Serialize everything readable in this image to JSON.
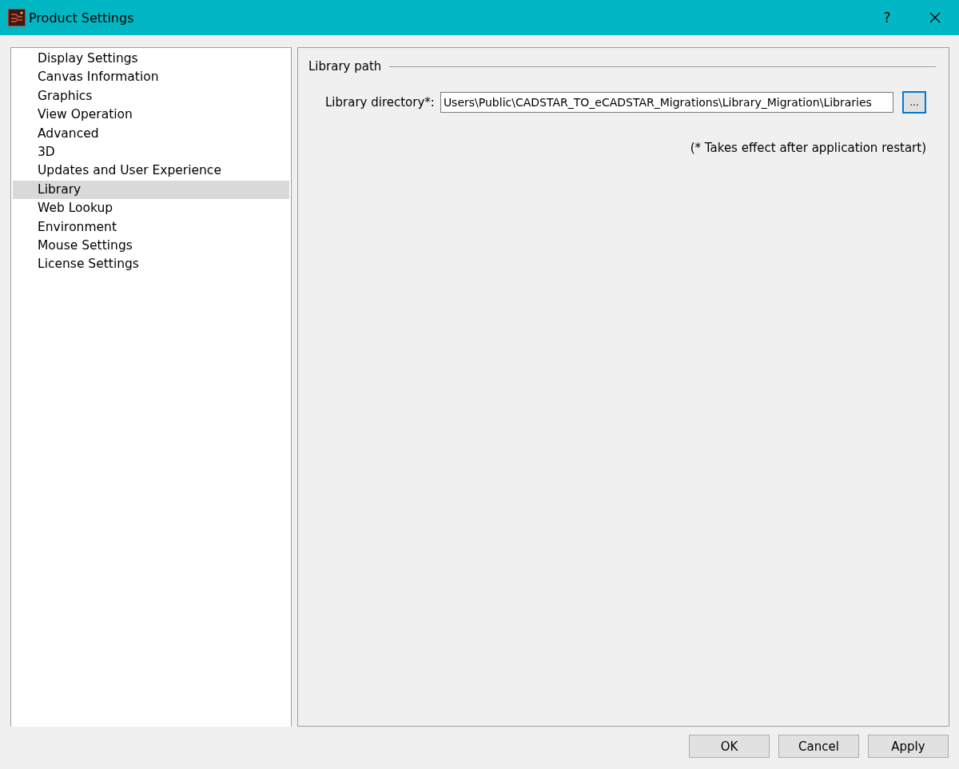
{
  "window": {
    "title": "Product Settings",
    "help": "?"
  },
  "sidebar": {
    "items": [
      {
        "label": "Display Settings",
        "selected": false
      },
      {
        "label": "Canvas Information",
        "selected": false
      },
      {
        "label": "Graphics",
        "selected": false
      },
      {
        "label": "View Operation",
        "selected": false
      },
      {
        "label": "Advanced",
        "selected": false
      },
      {
        "label": "3D",
        "selected": false
      },
      {
        "label": "Updates and User Experience",
        "selected": false
      },
      {
        "label": "Library",
        "selected": true
      },
      {
        "label": "Web Lookup",
        "selected": false
      },
      {
        "label": "Environment",
        "selected": false
      },
      {
        "label": "Mouse Settings",
        "selected": false
      },
      {
        "label": "License Settings",
        "selected": false
      }
    ]
  },
  "group": {
    "title": "Library path",
    "field_label": "Library directory*:",
    "value": "Users\\Public\\CADSTAR_TO_eCADSTAR_Migrations\\Library_Migration\\Libraries",
    "browse": "...",
    "note": "(* Takes effect after application restart)"
  },
  "buttons": [
    "OK",
    "Cancel",
    "Apply"
  ]
}
